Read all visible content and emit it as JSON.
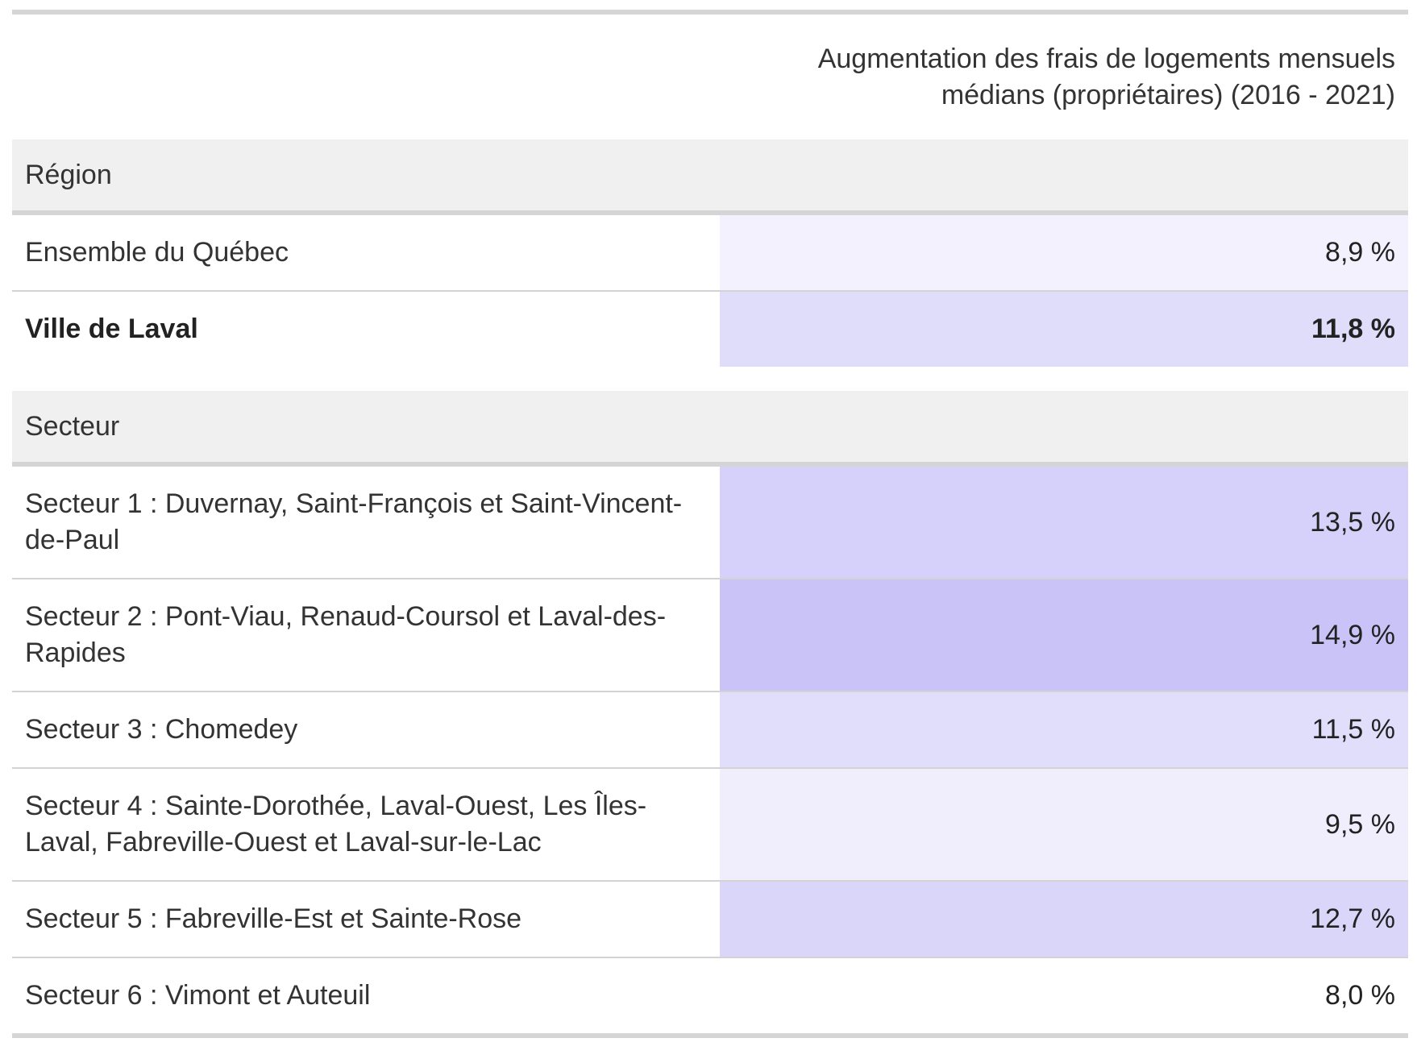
{
  "chart_data": {
    "type": "table",
    "column_header": "Augmentation des frais de logements mensuels médians (propriétaires) (2016 - 2021)",
    "groups": [
      {
        "label": "Région",
        "rows": [
          {
            "name": "Ensemble du Québec",
            "value": 8.9,
            "display": "8,9 %",
            "color": "#f3f1fe",
            "bold": false
          },
          {
            "name": "Ville de Laval",
            "value": 11.8,
            "display": "11,8 %",
            "color": "#e0ddfb",
            "bold": true
          }
        ]
      },
      {
        "label": "Secteur",
        "rows": [
          {
            "name": "Secteur 1 : Duvernay, Saint-François et Saint-Vincent-de-Paul",
            "value": 13.5,
            "display": "13,5 %",
            "color": "#d6d1fa",
            "bold": false
          },
          {
            "name": "Secteur 2 : Pont-Viau, Renaud-Coursol et Laval-des-Rapides",
            "value": 14.9,
            "display": "14,9 %",
            "color": "#c9c3f7",
            "bold": false
          },
          {
            "name": "Secteur 3 : Chomedey",
            "value": 11.5,
            "display": "11,5 %",
            "color": "#e1defb",
            "bold": false
          },
          {
            "name": "Secteur 4 : Sainte-Dorothée, Laval-Ouest, Les Îles-Laval, Fabreville-Ouest et Laval-sur-le-Lac",
            "value": 9.5,
            "display": "9,5 %",
            "color": "#f0eefd",
            "bold": false
          },
          {
            "name": "Secteur 5 : Fabreville-Est et Sainte-Rose",
            "value": 12.7,
            "display": "12,7 %",
            "color": "#dad6fa",
            "bold": false
          },
          {
            "name": "Secteur 6 : Vimont et Auteuil",
            "value": 8.0,
            "display": "8,0 %",
            "color": "#ffffff",
            "bold": false
          }
        ]
      }
    ]
  }
}
